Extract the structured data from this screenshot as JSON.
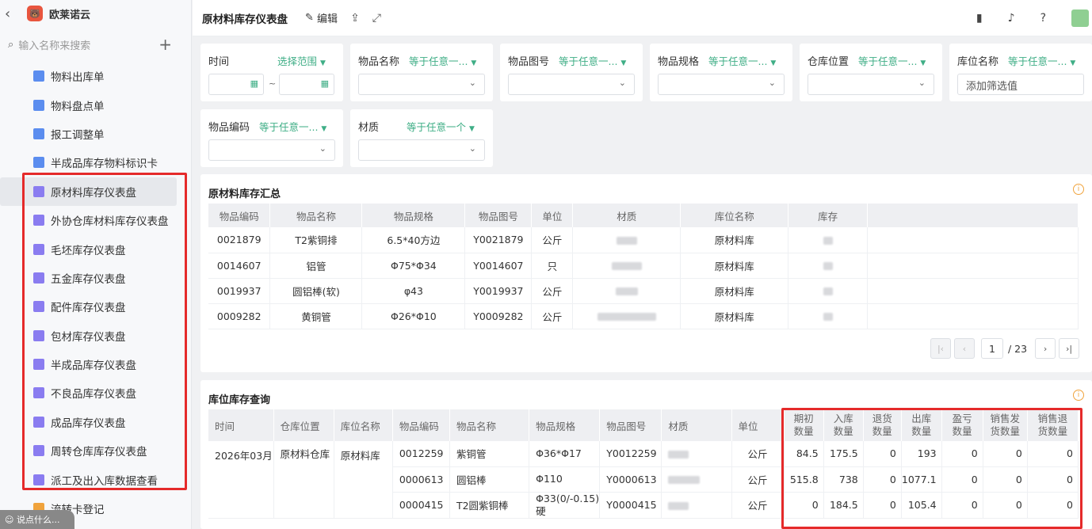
{
  "app": {
    "name": "欧莱诺云",
    "logo_glyph": "🐻"
  },
  "sidebar": {
    "search_placeholder": "输入名称来搜索",
    "items": [
      {
        "label": "物料出库单",
        "icon": "doc"
      },
      {
        "label": "物料盘点单",
        "icon": "doc"
      },
      {
        "label": "报工调整单",
        "icon": "doc"
      },
      {
        "label": "半成品库存物料标识卡",
        "icon": "doc"
      },
      {
        "label": "原材料库存仪表盘",
        "icon": "chart"
      },
      {
        "label": "外协仓库材料库存仪表盘",
        "icon": "chart"
      },
      {
        "label": "毛坯库存仪表盘",
        "icon": "chart"
      },
      {
        "label": "五金库存仪表盘",
        "icon": "chart"
      },
      {
        "label": "配件库存仪表盘",
        "icon": "chart"
      },
      {
        "label": "包材库存仪表盘",
        "icon": "chart"
      },
      {
        "label": "半成品库存仪表盘",
        "icon": "chart"
      },
      {
        "label": "不良品库存仪表盘",
        "icon": "chart"
      },
      {
        "label": "成品库存仪表盘",
        "icon": "chart"
      },
      {
        "label": "周转仓库库存仪表盘",
        "icon": "chart"
      },
      {
        "label": "派工及出入库数据查看",
        "icon": "chart"
      },
      {
        "label": "流转卡登记",
        "icon": "warn"
      }
    ],
    "assistant_placeholder": "说点什么..."
  },
  "header": {
    "title": "原材料库存仪表盘",
    "edit_label": "编辑"
  },
  "filters": {
    "time": {
      "label": "时间",
      "op": "选择范围"
    },
    "item_name": {
      "label": "物品名称",
      "op": "等于任意一..."
    },
    "item_drawing": {
      "label": "物品图号",
      "op": "等于任意一..."
    },
    "item_spec": {
      "label": "物品规格",
      "op": "等于任意一..."
    },
    "warehouse": {
      "label": "仓库位置",
      "op": "等于任意一..."
    },
    "location": {
      "label": "库位名称",
      "op": "等于任意一...",
      "value": "添加筛选值"
    },
    "item_code": {
      "label": "物品编码",
      "op": "等于任意一..."
    },
    "material": {
      "label": "材质",
      "op": "等于任意一个"
    }
  },
  "summary": {
    "title": "原材料库存汇总",
    "columns": [
      "物品编码",
      "物品名称",
      "物品规格",
      "物品图号",
      "单位",
      "材质",
      "库位名称",
      "库存"
    ],
    "rows": [
      {
        "code": "0021879",
        "name": "T2紫铜排",
        "spec": "6.5*40方边",
        "drawing": "Y0021879",
        "unit": "公斤",
        "location": "原材料库"
      },
      {
        "code": "0014607",
        "name": "铝管",
        "spec": "Φ75*Φ34",
        "drawing": "Y0014607",
        "unit": "只",
        "location": "原材料库"
      },
      {
        "code": "0019937",
        "name": "圆铝棒(软)",
        "spec": "φ43",
        "drawing": "Y0019937",
        "unit": "公斤",
        "location": "原材料库"
      },
      {
        "code": "0009282",
        "name": "黄铜管",
        "spec": "Φ26*Φ10",
        "drawing": "Y0009282",
        "unit": "公斤",
        "location": "原材料库"
      }
    ],
    "pager": {
      "current": "1",
      "total": "/ 23"
    }
  },
  "query": {
    "title": "库位库存查询",
    "columns": [
      "时间",
      "仓库位置",
      "库位名称",
      "物品编码",
      "物品名称",
      "物品规格",
      "物品图号",
      "材质",
      "单位"
    ],
    "num_columns": [
      [
        "期初",
        "数量"
      ],
      [
        "入库",
        "数量"
      ],
      [
        "退货",
        "数量"
      ],
      [
        "出库",
        "数量"
      ],
      [
        "盈亏",
        "数量"
      ],
      [
        "销售发",
        "货数量"
      ],
      [
        "销售退",
        "货数量"
      ]
    ],
    "group": {
      "time": "2026年03月",
      "warehouse": "原材料仓库",
      "location": "原材料库"
    },
    "rows": [
      {
        "code": "0012259",
        "name": "紫铜管",
        "spec": "Φ36*Φ17",
        "drawing": "Y0012259",
        "unit": "公斤",
        "nums": [
          "84.5",
          "175.5",
          "0",
          "193",
          "0",
          "0",
          "0"
        ]
      },
      {
        "code": "0000613",
        "name": "圆铝棒",
        "spec": "Φ110",
        "drawing": "Y0000613",
        "unit": "公斤",
        "nums": [
          "515.8",
          "738",
          "0",
          "1077.1",
          "0",
          "0",
          "0"
        ]
      },
      {
        "code": "0000415",
        "name": "T2圆紫铜棒",
        "spec": "Φ33(0/-0.15)硬",
        "drawing": "Y0000415",
        "unit": "公斤",
        "nums": [
          "0",
          "184.5",
          "0",
          "105.4",
          "0",
          "0",
          "0"
        ]
      }
    ]
  },
  "colors": {
    "accent": "#3fae86",
    "highlight": "#e52a2a",
    "warning": "#f0a33c"
  }
}
